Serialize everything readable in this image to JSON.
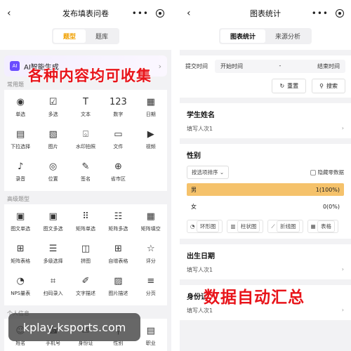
{
  "left": {
    "nav": {
      "back_icon": "chevron-left-icon",
      "title": "发布填表问卷"
    },
    "tabs": [
      "题型",
      "题库"
    ],
    "ai_card": {
      "badge": "AI",
      "text": "AI智能生成"
    },
    "overlay_text": "各种内容均可收集",
    "sections": [
      {
        "label": "常用题",
        "items": [
          {
            "icon": "◉",
            "label": "单选"
          },
          {
            "icon": "☑",
            "label": "多选"
          },
          {
            "icon": "T",
            "label": "文本"
          },
          {
            "icon": "123",
            "label": "数字"
          },
          {
            "icon": "▦",
            "label": "日期"
          },
          {
            "icon": "▤",
            "label": "下拉选择"
          },
          {
            "icon": "▧",
            "label": "图片"
          },
          {
            "icon": "⌺",
            "label": "水印拍照"
          },
          {
            "icon": "▭",
            "label": "文件"
          },
          {
            "icon": "▶",
            "label": "视频"
          },
          {
            "icon": "♪",
            "label": "录音"
          },
          {
            "icon": "◎",
            "label": "位置"
          },
          {
            "icon": "✎",
            "label": "签名"
          },
          {
            "icon": "⊕",
            "label": "省市区"
          }
        ]
      },
      {
        "label": "高级题型",
        "items": [
          {
            "icon": "▣",
            "label": "图文单选"
          },
          {
            "icon": "▣",
            "label": "图文多选"
          },
          {
            "icon": "⠿",
            "label": "矩阵单选"
          },
          {
            "icon": "☷",
            "label": "矩阵多选"
          },
          {
            "icon": "▦",
            "label": "矩阵填空"
          },
          {
            "icon": "⊞",
            "label": "矩阵表格"
          },
          {
            "icon": "☰",
            "label": "多级选择"
          },
          {
            "icon": "◫",
            "label": "拼图"
          },
          {
            "icon": "⊞",
            "label": "自增表格"
          },
          {
            "icon": "☆",
            "label": "评分"
          },
          {
            "icon": "◔",
            "label": "NPS量表"
          },
          {
            "icon": "⌗",
            "label": "扫码录入"
          },
          {
            "icon": "✐",
            "label": "文字描述"
          },
          {
            "icon": "▨",
            "label": "图片描述"
          },
          {
            "icon": "≡",
            "label": "分页"
          }
        ]
      },
      {
        "label": "个人信息",
        "items": [
          {
            "icon": "☺",
            "label": "姓名"
          },
          {
            "icon": "☎",
            "label": "手机号"
          },
          {
            "icon": "✉",
            "label": "身份证"
          },
          {
            "icon": "⚲",
            "label": "性别"
          },
          {
            "icon": "▤",
            "label": "职业"
          }
        ]
      }
    ]
  },
  "right": {
    "nav": {
      "back_icon": "chevron-left-icon",
      "title": "图表统计"
    },
    "tabs": [
      "图表统计",
      "来源分析"
    ],
    "filter": {
      "label": "提交时间",
      "start": "开始时间",
      "sep": "-",
      "end": "结束时间"
    },
    "buttons": {
      "reset": "重置",
      "search": "搜索"
    },
    "questions": [
      {
        "title": "学生姓名",
        "count": "填写人次1"
      },
      {
        "title": "性别",
        "sort": "按选项排序",
        "hide_zero": "隐藏零数据",
        "options": [
          {
            "name": "男",
            "value": "1(100%)",
            "fraction": 1.0
          },
          {
            "name": "女",
            "value": "0(0%)",
            "fraction": 0.0
          }
        ],
        "chart_types": [
          "环形图",
          "柱状图",
          "折线图",
          "表格"
        ]
      },
      {
        "title": "出生日期",
        "count": "填写人次1"
      },
      {
        "title": "身份证",
        "count": "填写人次1"
      }
    ],
    "overlay_text": "数据自动汇总"
  },
  "watermark": "kplay-ksports.com",
  "colors": {
    "accent": "#f0a000",
    "bar": "#f5c26b",
    "overlay": "#e8141a",
    "ai": "#6a4cff"
  }
}
